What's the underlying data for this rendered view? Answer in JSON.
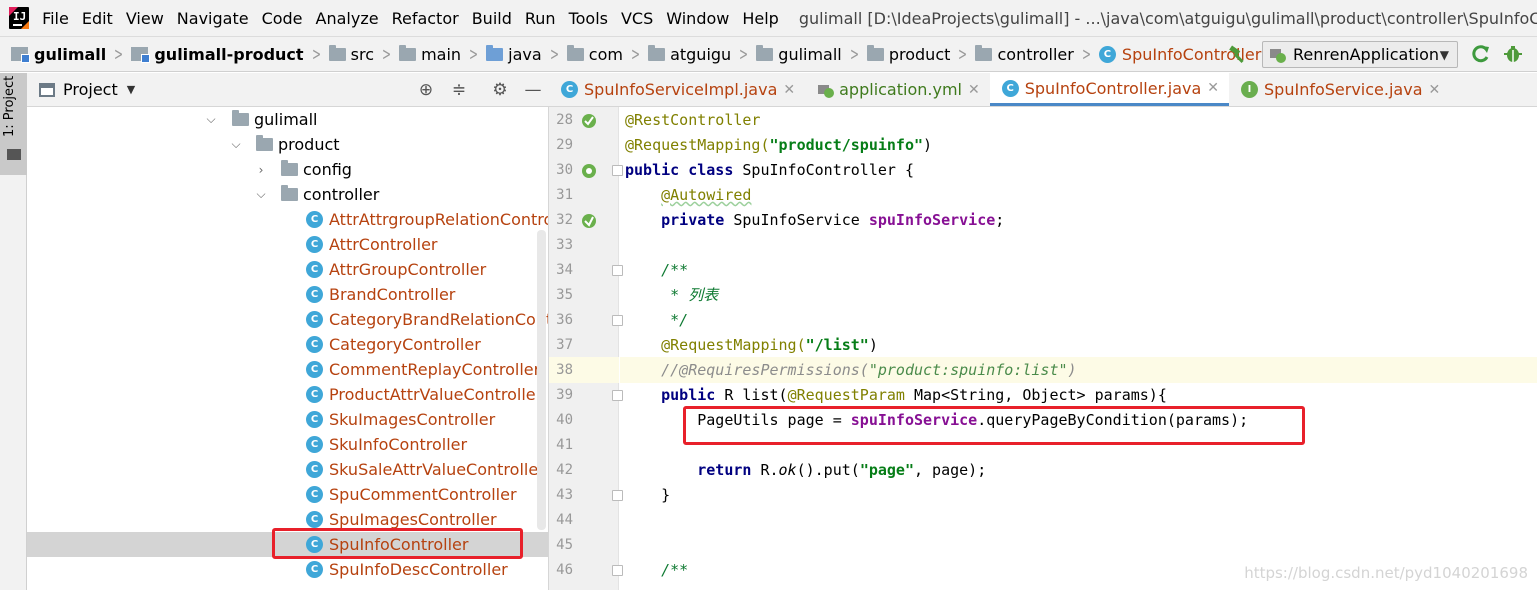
{
  "menu": {
    "items": [
      "File",
      "Edit",
      "View",
      "Navigate",
      "Code",
      "Analyze",
      "Refactor",
      "Build",
      "Run",
      "Tools",
      "VCS",
      "Window",
      "Help"
    ],
    "window_title": "gulimall [D:\\IdeaProjects\\gulimall] - ...\\java\\com\\atguigu\\gulimall\\product\\controller\\SpuInfoController"
  },
  "breadcrumb": [
    "gulimall",
    "gulimall-product",
    "src",
    "main",
    "java",
    "com",
    "atguigu",
    "gulimall",
    "product",
    "controller",
    "SpuInfoController"
  ],
  "run_config": {
    "label": "RenrenApplication"
  },
  "tool_strip": {
    "project_tab": "1: Project"
  },
  "project_panel": {
    "title": "Project",
    "tree": [
      {
        "label": "gulimall",
        "type": "package"
      },
      {
        "label": "product",
        "type": "package"
      },
      {
        "label": "config",
        "type": "package"
      },
      {
        "label": "controller",
        "type": "package"
      },
      {
        "label": "AttrAttrgroupRelationControll",
        "type": "class"
      },
      {
        "label": "AttrController",
        "type": "class"
      },
      {
        "label": "AttrGroupController",
        "type": "class"
      },
      {
        "label": "BrandController",
        "type": "class"
      },
      {
        "label": "CategoryBrandRelationContro",
        "type": "class"
      },
      {
        "label": "CategoryController",
        "type": "class"
      },
      {
        "label": "CommentReplayController",
        "type": "class"
      },
      {
        "label": "ProductAttrValueController",
        "type": "class"
      },
      {
        "label": "SkuImagesController",
        "type": "class"
      },
      {
        "label": "SkuInfoController",
        "type": "class"
      },
      {
        "label": "SkuSaleAttrValueController",
        "type": "class"
      },
      {
        "label": "SpuCommentController",
        "type": "class"
      },
      {
        "label": "SpuImagesController",
        "type": "class"
      },
      {
        "label": "SpuInfoController",
        "type": "class",
        "selected": true
      },
      {
        "label": "SpuInfoDescController",
        "type": "class"
      }
    ]
  },
  "editor_tabs": [
    {
      "label": "SpuInfoServiceImpl.java",
      "icon": "class-icon"
    },
    {
      "label": "application.yml",
      "icon": "yml-icon"
    },
    {
      "label": "SpuInfoController.java",
      "icon": "class-icon",
      "active": true
    },
    {
      "label": "SpuInfoService.java",
      "icon": "interface-icon"
    }
  ],
  "editor": {
    "lines": {
      "l28": {
        "n": "28",
        "a": "@RestController"
      },
      "l29": {
        "n": "29",
        "a": "@RequestMapping(",
        "s": "\"product/spuinfo\"",
        "e": ")"
      },
      "l30": {
        "n": "30",
        "k1": "public",
        "k2": "class",
        "t": " SpuInfoController {"
      },
      "l31": {
        "n": "31",
        "a": "@Autowired"
      },
      "l32": {
        "n": "32",
        "k": "private",
        "t": " SpuInfoService ",
        "f": "spuInfoService",
        "e": ";"
      },
      "l33": {
        "n": "33"
      },
      "l34": {
        "n": "34",
        "d": "/**"
      },
      "l35": {
        "n": "35",
        "d": " * 列表"
      },
      "l36": {
        "n": "36",
        "d": " */"
      },
      "l37": {
        "n": "37",
        "a": "@RequestMapping(",
        "s": "\"/list\"",
        "e": ")"
      },
      "l38": {
        "n": "38",
        "c1": "//@RequiresPermissions(",
        "c2": "\"product:spuinfo:list\"",
        "c3": ")"
      },
      "l39": {
        "n": "39",
        "k": "public",
        "t1": " R list(",
        "a": "@RequestParam",
        "t2": " Map<String, Object> params){"
      },
      "l40": {
        "n": "40",
        "t1": "PageUtils page = ",
        "f": "spuInfoService",
        "t2": ".queryPageByCondition(params);"
      },
      "l41": {
        "n": "41"
      },
      "l42": {
        "n": "42",
        "k": "return",
        "t1": " R.",
        "i": "ok",
        "t2": "().put(",
        "s": "\"page\"",
        "t3": ", page);"
      },
      "l43": {
        "n": "43",
        "t": "}"
      },
      "l44": {
        "n": "44"
      },
      "l45": {
        "n": "45"
      },
      "l46": {
        "n": "46",
        "d": "/**"
      }
    }
  },
  "watermark": "https://blog.csdn.net/pyd1040201698",
  "colors": {
    "highlight": "#e8202a",
    "accent": "#4a88c7",
    "class_name": "#b6420f"
  }
}
